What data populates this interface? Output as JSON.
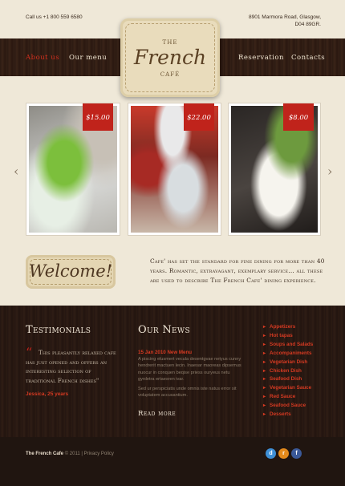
{
  "header": {
    "phone": "Call us +1 800 559 6580",
    "address_line1": "8901 Marmora Road, Glasgow,",
    "address_line2": "D04 89GR."
  },
  "logo": {
    "the": "THE",
    "name": "French",
    "cafe": "CAFÉ"
  },
  "nav": {
    "about": "About us",
    "menu": "Our menu",
    "reservation": "Reservation",
    "contacts": "Contacts"
  },
  "gallery": {
    "prev": "‹",
    "next": "›",
    "items": [
      {
        "price": "$15.00"
      },
      {
        "price": "$22.00"
      },
      {
        "price": "$8.00"
      }
    ]
  },
  "welcome": {
    "title": "Welcome!",
    "text": "Cafe' has set the standard for fine dining for more than 40 years. Romantic, extravagant, exemplary service... all these are used to describe The French Cafe' dining experience."
  },
  "testimonials": {
    "title": "Testimonials",
    "quote": "This pleasantly relaxed cafe has just opened and offers an interesting selection of traditional French dishes\"",
    "author": "Jessica, 25 years"
  },
  "news": {
    "title": "Our News",
    "date_title": "15 Jan 2010 New Menu",
    "text1": "A piscing elusmert vecula desentgvae netyus cunny hendrerit mactuen lecin. Inaesar maoreas dipsemus nuocur in conquen beqise priess ouryeus netu gyrdetra ertaesren ivar.",
    "text2": "Sed ur perspiciatis unde omnis iste natus error sit voluptatem accusantium.",
    "read_more": "Read more"
  },
  "menu_list": [
    "Appetizers",
    "Hot tapas",
    "Soups and Salads",
    "Accompaniments",
    "Vegetarian Dish",
    "Chicken Dish",
    "Seafood Dish",
    "Vegetarian Sauce",
    "Red Sauce",
    "Seafood Sauce",
    "Desserts"
  ],
  "footer": {
    "brand": "The French Cafe",
    "copyright": "© 2011",
    "separator": "|",
    "privacy": "Privacy Policy"
  },
  "social": [
    {
      "icon": "delicious-icon",
      "glyph": "d",
      "color": "#3e8fd6"
    },
    {
      "icon": "rss-icon",
      "glyph": "r",
      "color": "#e48a1c"
    },
    {
      "icon": "facebook-icon",
      "glyph": "f",
      "color": "#3b5998"
    }
  ],
  "colors": {
    "accent": "#d3301e",
    "dark": "#2b1a12",
    "cream": "#efe8d8"
  }
}
